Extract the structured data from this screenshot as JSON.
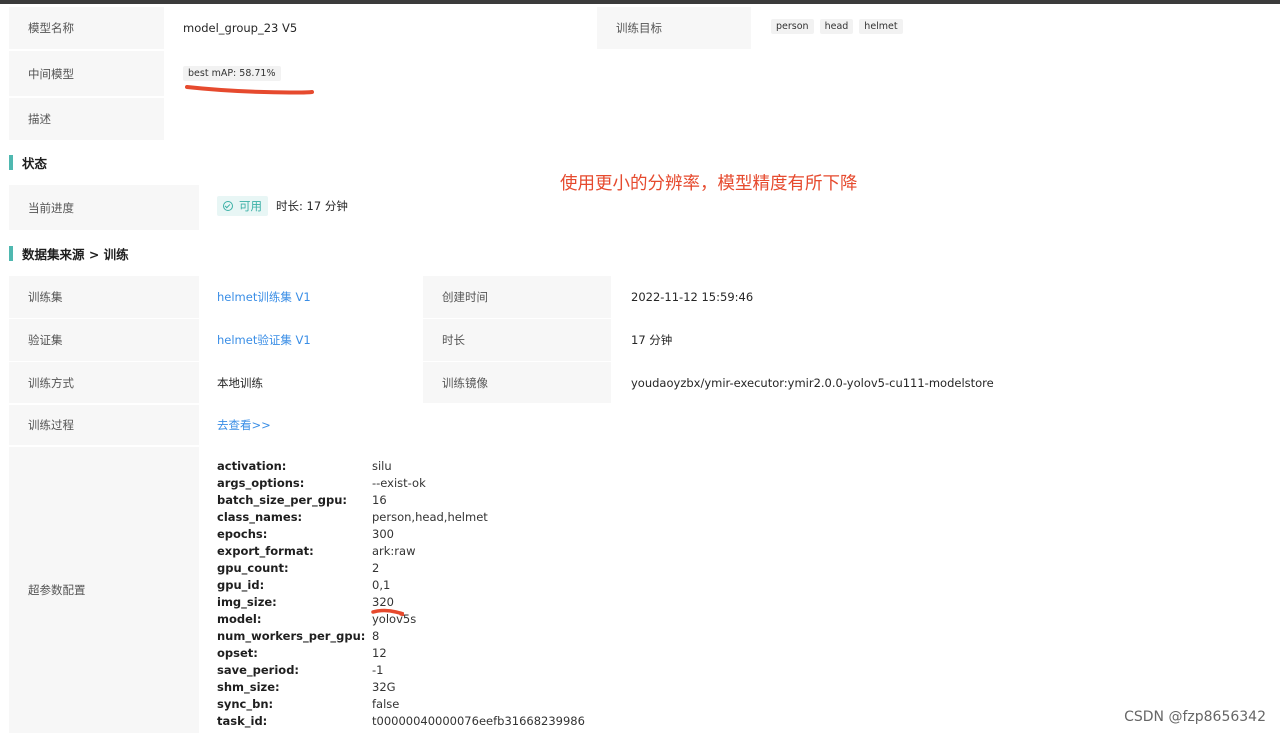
{
  "model": {
    "name_label": "模型名称",
    "name_value": "model_group_23 V5",
    "target_label": "训练目标",
    "targets": [
      "person",
      "head",
      "helmet"
    ],
    "intermediate_label": "中间模型",
    "intermediate_value": "best mAP: 58.71%",
    "desc_label": "描述",
    "desc_value": ""
  },
  "status_section": {
    "title": "状态",
    "progress_label": "当前进度",
    "status_badge": "可用",
    "duration_text": "时长: 17 分钟"
  },
  "annotation": "使用更小的分辨率，模型精度有所下降",
  "dataset_section": {
    "title": "数据集来源 > 训练",
    "train_set_label": "训练集",
    "train_set_value": "helmet训练集 V1",
    "created_label": "创建时间",
    "created_value": "2022-11-12 15:59:46",
    "val_set_label": "验证集",
    "val_set_value": "helmet验证集 V1",
    "duration_label": "时长",
    "duration_value": "17 分钟",
    "method_label": "训练方式",
    "method_value": "本地训练",
    "image_label": "训练镜像",
    "image_value": "youdaoyzbx/ymir-executor:ymir2.0.0-yolov5-cu111-modelstore",
    "process_label": "训练过程",
    "process_link": "去查看>>",
    "hyper_label": "超参数配置",
    "hyper_params": [
      {
        "key": "activation:",
        "value": "silu"
      },
      {
        "key": "args_options:",
        "value": "--exist-ok"
      },
      {
        "key": "batch_size_per_gpu:",
        "value": "16"
      },
      {
        "key": "class_names:",
        "value": "person,head,helmet"
      },
      {
        "key": "epochs:",
        "value": "300"
      },
      {
        "key": "export_format:",
        "value": "ark:raw"
      },
      {
        "key": "gpu_count:",
        "value": "2"
      },
      {
        "key": "gpu_id:",
        "value": "0,1"
      },
      {
        "key": "img_size:",
        "value": "320"
      },
      {
        "key": "model:",
        "value": "yolov5s"
      },
      {
        "key": "num_workers_per_gpu:",
        "value": "8"
      },
      {
        "key": "opset:",
        "value": "12"
      },
      {
        "key": "save_period:",
        "value": "-1"
      },
      {
        "key": "shm_size:",
        "value": "32G"
      },
      {
        "key": "sync_bn:",
        "value": "false"
      },
      {
        "key": "task_id:",
        "value": "t00000040000076eefb31668239986"
      }
    ]
  },
  "watermark": "CSDN @fzp8656342",
  "colors": {
    "accent": "#4fb8b0",
    "link": "#3a8ee6",
    "annotation": "#e64a2e"
  }
}
